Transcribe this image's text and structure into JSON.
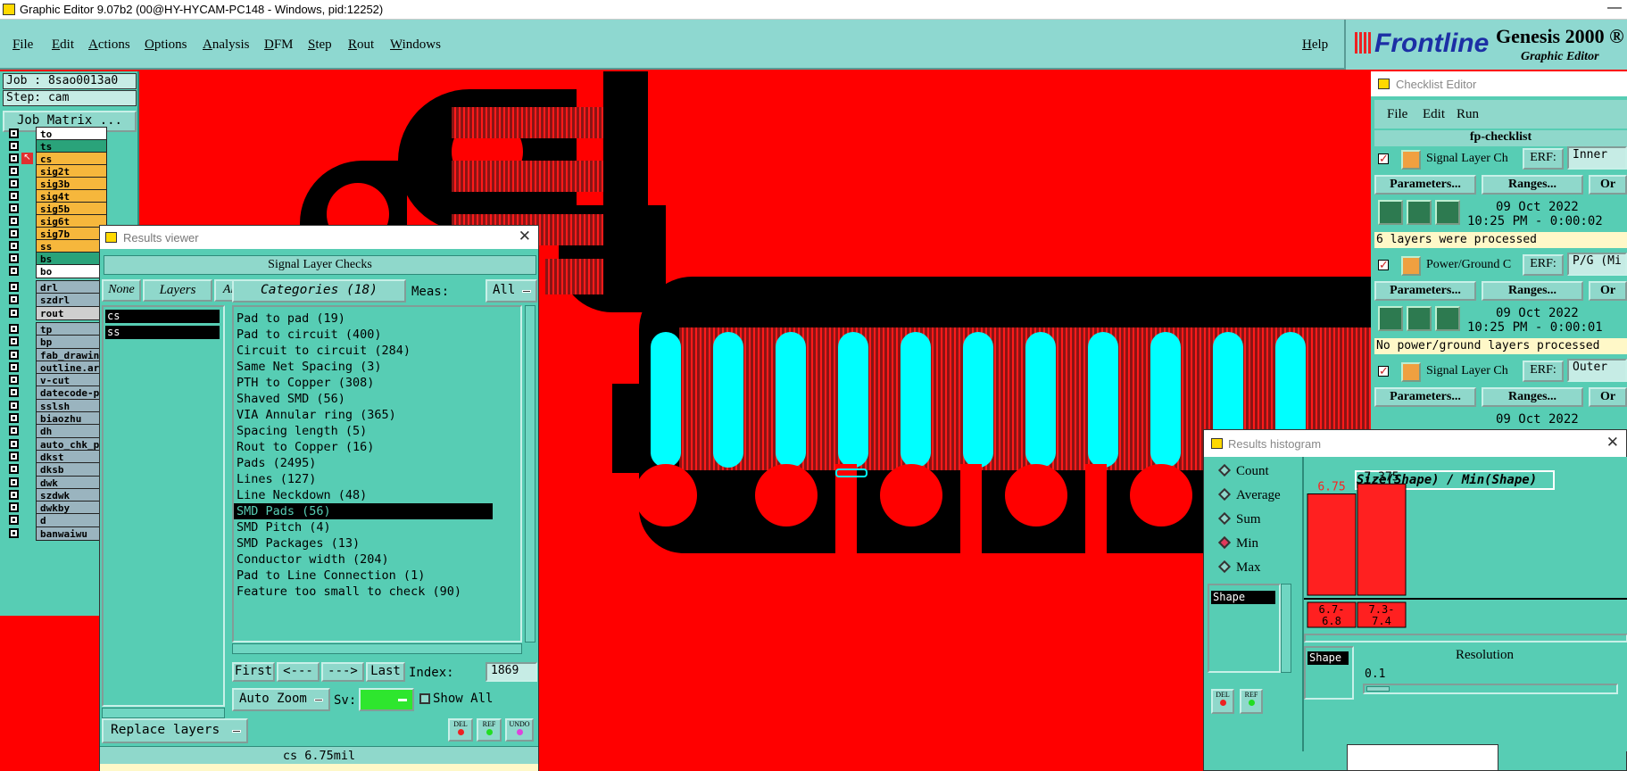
{
  "window": {
    "title": "Graphic Editor 9.07b2 (00@HY-HYCAM-PC148 - Windows, pid:12252)",
    "minimize": "—"
  },
  "menu": [
    "File",
    "Edit",
    "Actions",
    "Options",
    "Analysis",
    "DFM",
    "Step",
    "Rout",
    "Windows"
  ],
  "help": "Help",
  "brand": {
    "logo": "Frontline",
    "product": "Genesis 2000 ®",
    "subtitle": "Graphic Editor"
  },
  "job": {
    "job_label": "Job : 8sao0013a0",
    "step_label": "Step: cam",
    "matrix_button": "Job Matrix ..."
  },
  "layers": [
    {
      "name": "to",
      "color": "#ffffff"
    },
    {
      "name": "ts",
      "color": "#2aa37a"
    },
    {
      "name": "cs",
      "color": "#f6b73c"
    },
    {
      "name": "sig2t",
      "color": "#f6b73c"
    },
    {
      "name": "sig3b",
      "color": "#f6b73c"
    },
    {
      "name": "sig4t",
      "color": "#f6b73c"
    },
    {
      "name": "sig5b",
      "color": "#f6b73c"
    },
    {
      "name": "sig6t",
      "color": "#f6b73c"
    },
    {
      "name": "sig7b",
      "color": "#f6b73c"
    },
    {
      "name": "ss",
      "color": "#f6b73c"
    },
    {
      "name": "bs",
      "color": "#2aa37a"
    },
    {
      "name": "bo",
      "color": "#ffffff"
    },
    {
      "name": "drl",
      "color": "#9ab4bf"
    },
    {
      "name": "szdrl",
      "color": "#9ab4bf"
    },
    {
      "name": "rout",
      "color": "#cfcfcf"
    },
    {
      "name": "tp",
      "color": "#9ab4bf"
    },
    {
      "name": "bp",
      "color": "#9ab4bf"
    },
    {
      "name": "fab_drawin",
      "color": "#9ab4bf"
    },
    {
      "name": "outline.ar",
      "color": "#9ab4bf"
    },
    {
      "name": "v-cut",
      "color": "#9ab4bf"
    },
    {
      "name": "datecode-p",
      "color": "#9ab4bf"
    },
    {
      "name": "sslsh",
      "color": "#9ab4bf"
    },
    {
      "name": "biaozhu",
      "color": "#9ab4bf"
    },
    {
      "name": "dh",
      "color": "#9ab4bf"
    },
    {
      "name": "auto_chk_p",
      "color": "#9ab4bf"
    },
    {
      "name": "dkst",
      "color": "#9ab4bf"
    },
    {
      "name": "dksb",
      "color": "#9ab4bf"
    },
    {
      "name": "dwk",
      "color": "#9ab4bf"
    },
    {
      "name": "szdwk",
      "color": "#9ab4bf"
    },
    {
      "name": "dwkby",
      "color": "#9ab4bf"
    },
    {
      "name": "d",
      "color": "#9ab4bf"
    },
    {
      "name": "banwaiwu",
      "color": "#9ab4bf"
    }
  ],
  "results_viewer": {
    "title": "Results viewer",
    "header": "Signal Layer Checks",
    "none_btn": "None",
    "layers_btn": "Layers",
    "all_btn": "All",
    "layers": [
      "cs",
      "ss"
    ],
    "categories_btn": "Categories (18)",
    "meas_label": "Meas:",
    "meas_value": "All",
    "categories": [
      "Pad to pad (19)",
      "Pad to circuit (400)",
      "Circuit to circuit (284)",
      "Same Net Spacing (3)",
      "PTH to Copper (308)",
      "Shaved SMD (56)",
      "VIA Annular ring (365)",
      "Spacing length (5)",
      "Rout to Copper (16)",
      "Pads (2495)",
      "Lines (127)",
      "Line Neckdown (48)",
      "SMD Pads (56)",
      "SMD Pitch (4)",
      "SMD Packages (13)",
      "Conductor width (204)",
      "Pad to Line Connection (1)",
      "Feature too small to check (90)"
    ],
    "selected_index": 12,
    "first_btn": "First",
    "prev_btn": "<---",
    "next_btn": "--->",
    "last_btn": "Last",
    "index_label": "Index:",
    "index_value": "1869",
    "auto_zoom": "Auto Zoom",
    "sv_label": "Sv:",
    "show_all": "Show All",
    "replace_layers": "Replace layers",
    "status": "cs 6.75mil",
    "del_btn": "DEL",
    "ref_btn": "REF",
    "undo_btn": "UNDO"
  },
  "checklist_editor": {
    "title": "Checklist Editor",
    "menu": [
      "File",
      "Edit",
      "Run"
    ],
    "checklist_name": "fp-checklist",
    "items": [
      {
        "name": "Signal Layer Ch",
        "erf": "ERF:",
        "erf_value": "Inner",
        "params": "Parameters...",
        "ranges": "Ranges...",
        "more": "Or",
        "date": "09 Oct 2022",
        "time": "10:25 PM - 0:00:02",
        "message": "6 layers were processed"
      },
      {
        "name": "Power/Ground C",
        "erf": "ERF:",
        "erf_value": "P/G (Mi",
        "params": "Parameters...",
        "ranges": "Ranges...",
        "more": "Or",
        "date": "09 Oct 2022",
        "time": "10:25 PM - 0:00:01",
        "message": "No power/ground layers processed"
      },
      {
        "name": "Signal Layer Ch",
        "erf": "ERF:",
        "erf_value": "Outer",
        "params": "Parameters...",
        "ranges": "Ranges...",
        "more": "Or",
        "date": "09 Oct 2022",
        "time": "",
        "message": ""
      }
    ]
  },
  "histogram": {
    "title": "Results histogram",
    "modes": [
      "Count",
      "Average",
      "Sum",
      "Min",
      "Max"
    ],
    "selected_mode": "Min",
    "list_item": "Shape",
    "chart_title": "Size(Shape) / Min(Shape)",
    "del_btn": "DEL",
    "ref_btn": "REF",
    "shape_label": "Shape",
    "resolution_label": "Resolution",
    "resolution_value": "0.1"
  },
  "chart_data": {
    "type": "bar",
    "title": "Size(Shape) / Min(Shape)",
    "categories": [
      "6.7-6.8",
      "7.3-7.4"
    ],
    "values": [
      6.75,
      7.375
    ],
    "value_labels": [
      "6.75",
      "7.375"
    ],
    "cat_labels": [
      [
        "6.7-",
        "6.8"
      ],
      [
        "7.3-",
        "7.4"
      ]
    ],
    "bar_color": "#ff2020"
  }
}
